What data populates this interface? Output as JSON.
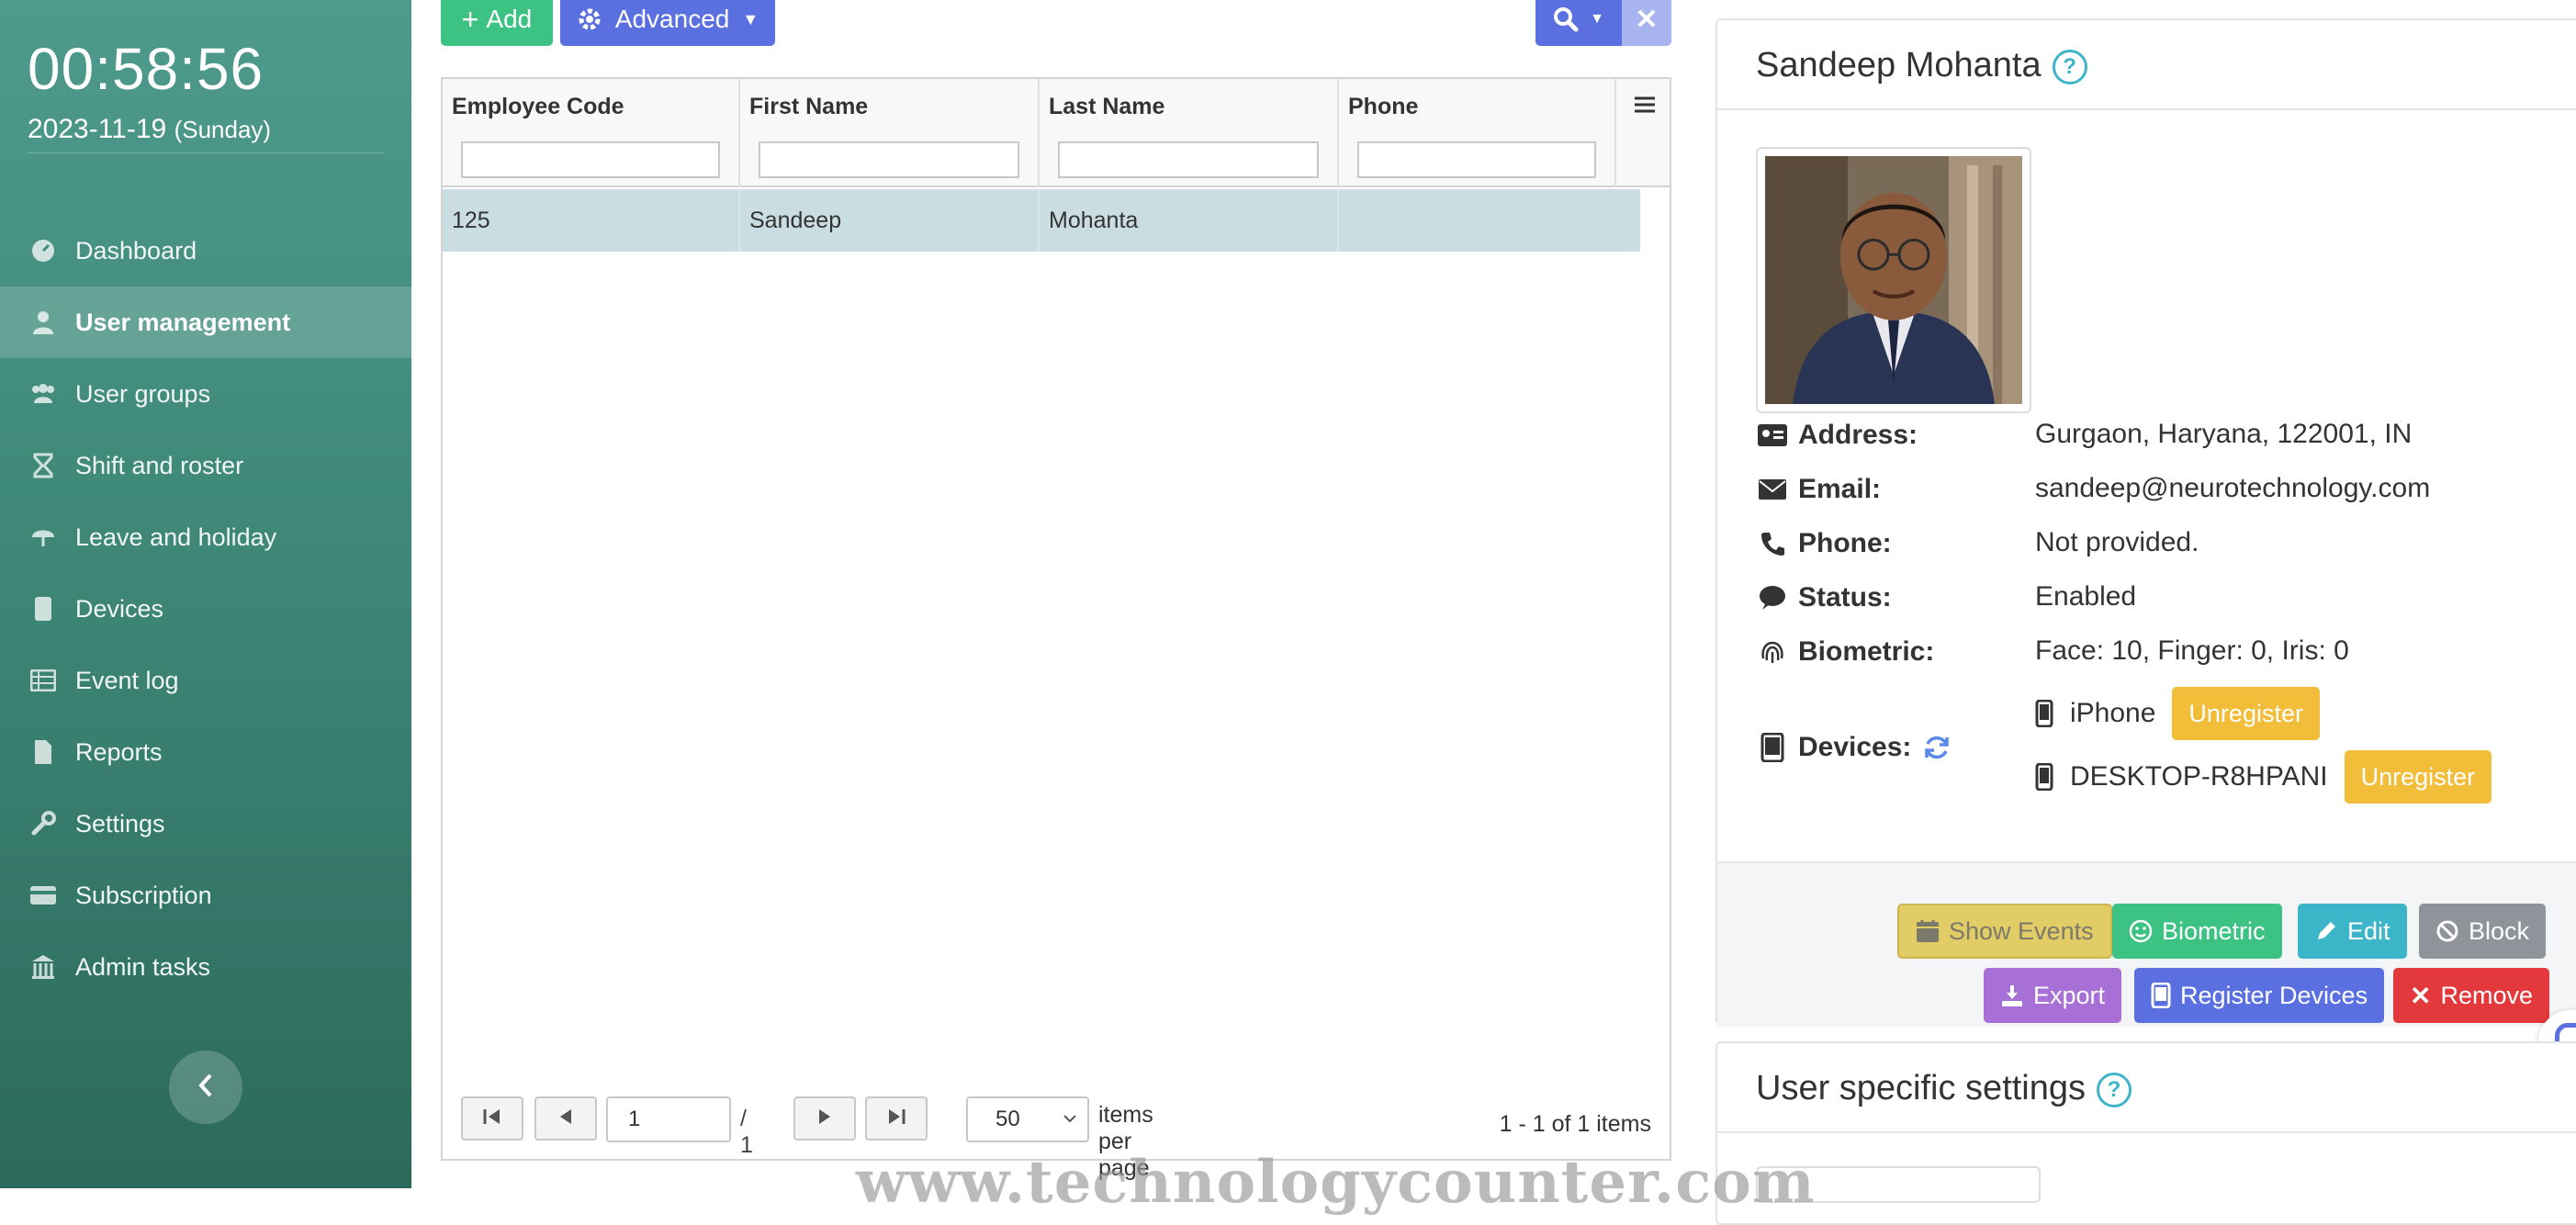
{
  "sidebar": {
    "clock": "00:58:56",
    "date": "2023-11-19",
    "day": "(Sunday)",
    "items": [
      {
        "label": "Dashboard",
        "icon": "gauge-icon",
        "active": false
      },
      {
        "label": "User management",
        "icon": "user-icon",
        "active": true
      },
      {
        "label": "User groups",
        "icon": "users-icon",
        "active": false
      },
      {
        "label": "Shift and roster",
        "icon": "hourglass-icon",
        "active": false
      },
      {
        "label": "Leave and holiday",
        "icon": "umbrella-icon",
        "active": false
      },
      {
        "label": "Devices",
        "icon": "device-icon",
        "active": false
      },
      {
        "label": "Event log",
        "icon": "list-icon",
        "active": false
      },
      {
        "label": "Reports",
        "icon": "file-icon",
        "active": false
      },
      {
        "label": "Settings",
        "icon": "wrench-icon",
        "active": false
      },
      {
        "label": "Subscription",
        "icon": "credit-card-icon",
        "active": false
      },
      {
        "label": "Admin tasks",
        "icon": "building-icon",
        "active": false
      }
    ]
  },
  "toolbar": {
    "add_label": "Add",
    "advanced_label": "Advanced"
  },
  "grid": {
    "columns": [
      "Employee Code",
      "First Name",
      "Last Name",
      "Phone"
    ],
    "rows": [
      {
        "employee_code": "125",
        "first_name": "Sandeep",
        "last_name": "Mohanta",
        "phone": ""
      }
    ],
    "pager": {
      "page": "1",
      "total_pages": "/ 1",
      "page_size": "50",
      "page_size_label": "items per page",
      "info": "1 - 1 of 1 items"
    }
  },
  "detail": {
    "name": "Sandeep Mohanta",
    "help": "?",
    "address_label": "Address:",
    "address": "Gurgaon, Haryana, 122001, IN",
    "email_label": "Email:",
    "email": "sandeep@neurotechnology.com",
    "phone_label": "Phone:",
    "phone": "Not provided.",
    "status_label": "Status:",
    "status": "Enabled",
    "biometric_label": "Biometric:",
    "biometric": "Face: 10, Finger: 0, Iris: 0",
    "devices_label": "Devices:",
    "devices": [
      {
        "name": "iPhone",
        "action": "Unregister"
      },
      {
        "name": "DESKTOP-R8HPANI",
        "action": "Unregister"
      }
    ],
    "actions": {
      "show_events": "Show Events",
      "biometric": "Biometric",
      "edit": "Edit",
      "block": "Block",
      "export": "Export",
      "register_devices": "Register Devices",
      "remove": "Remove"
    }
  },
  "settings_panel": {
    "title": "User specific settings",
    "help": "?"
  },
  "watermark": "www.technologycounter.com",
  "colors": {
    "sidebar": "#3f8878",
    "primary": "#5a6fe0",
    "success": "#3cc383",
    "warning": "#f2be3a",
    "info": "#3cb5c8",
    "danger": "#e4393c",
    "purple": "#a86fd6",
    "grey": "#8e9499"
  }
}
